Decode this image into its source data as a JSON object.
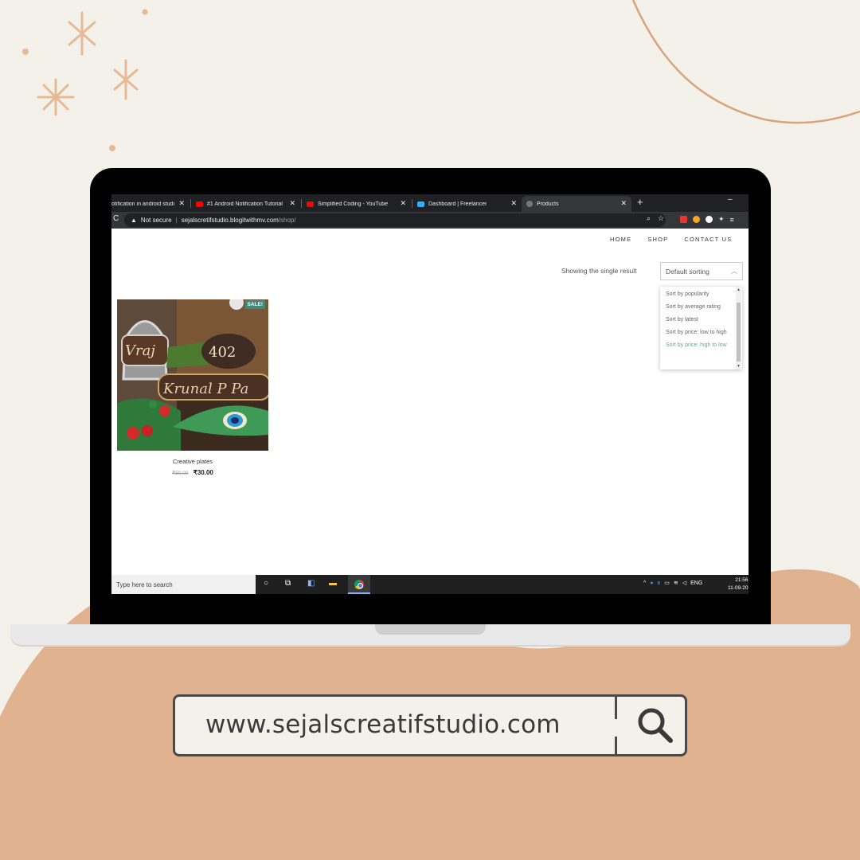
{
  "browser": {
    "tabs": [
      {
        "title": "otification in android studi",
        "favicon": "globe-icon",
        "active": false
      },
      {
        "title": "#1 Android Notification Tutorial",
        "favicon": "youtube-icon",
        "active": false
      },
      {
        "title": "Simplified Coding - YouTube",
        "favicon": "youtube-icon",
        "active": false
      },
      {
        "title": "Dashboard | Freelancer",
        "favicon": "freelancer-icon",
        "active": false
      },
      {
        "title": "Products",
        "favicon": "globe-icon",
        "active": true
      }
    ],
    "new_tab": "+",
    "minimize": "–",
    "address": {
      "security": "Not secure",
      "host": "sejalscretifstudio.blogitwithmv.com",
      "path": "/shop/"
    }
  },
  "site": {
    "nav": [
      "HOME",
      "SHOP",
      "CONTACT US"
    ],
    "result_count": "Showing the single result",
    "sort": {
      "selected": "Default sorting",
      "options": [
        "Sort by popularity",
        "Sort by average rating",
        "Sort by latest",
        "Sort by price: low to high",
        "Sort by price: high to low"
      ],
      "highlighted_index": 4
    },
    "product": {
      "badge": "SALE!",
      "name": "Creative plates",
      "old_price": "₹50.00",
      "price": "₹30.00",
      "plate_text_1": "Vraj",
      "plate_text_2": "402",
      "plate_text_3": "Krunal P Pa"
    }
  },
  "taskbar": {
    "search_placeholder": "Type here to search",
    "language": "ENG",
    "time": "21:56",
    "date": "11-09-20"
  },
  "url_banner": {
    "text": "www.sejalscreatifstudio.com"
  },
  "colors": {
    "background": "#f4f1eb",
    "blob": "#e0b290",
    "accent_teal": "#3e8a7d",
    "sparkle": "#e8b995"
  }
}
